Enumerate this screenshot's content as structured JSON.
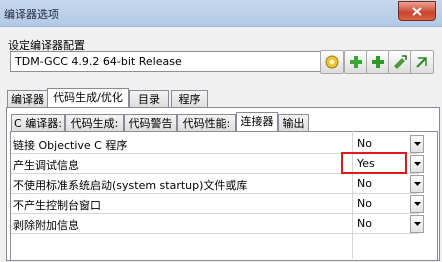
{
  "window": {
    "title": "编译器选项"
  },
  "compiler_group": {
    "label": "设定编译器配置",
    "selected": "TDM-GCC 4.9.2 64-bit Release"
  },
  "toolbar_icons": [
    "star-cog-icon",
    "add-icon",
    "add-alt-icon",
    "rename-icon",
    "delete-icon"
  ],
  "main_tabs": [
    {
      "label": "编译器"
    },
    {
      "label": "代码生成/优化"
    },
    {
      "label": "目录"
    },
    {
      "label": "程序"
    }
  ],
  "sub_tabs": [
    {
      "label": "C 编译器:"
    },
    {
      "label": "代码生成:"
    },
    {
      "label": "代码警告"
    },
    {
      "label": "代码性能:"
    },
    {
      "label": "连接器"
    },
    {
      "label": "输出"
    }
  ],
  "options": [
    {
      "label": "链接 Objective C 程序",
      "value": "No"
    },
    {
      "label": "产生调试信息",
      "value": "Yes"
    },
    {
      "label": "不使用标准系统启动(system startup)文件或库",
      "value": "No"
    },
    {
      "label": "不产生控制台窗口",
      "value": "No"
    },
    {
      "label": "剥除附加信息",
      "value": "No"
    }
  ],
  "colors": {
    "highlight": "#e0191f",
    "titlebar": "#c7d8ee",
    "close": "#c8442d"
  }
}
